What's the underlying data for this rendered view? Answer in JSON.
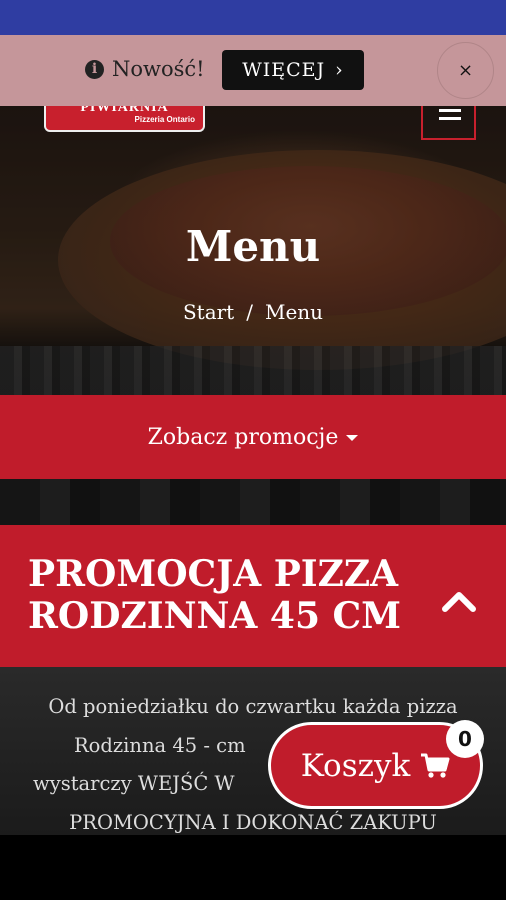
{
  "notice": {
    "text": "Nowość!",
    "button_label": "WIĘCEJ",
    "button_chevron": "›",
    "close_label": "×",
    "info_icon_glyph": "i"
  },
  "header": {
    "logo_top": "PIWIARNIA",
    "logo_sub": "Pizzeria Ontario"
  },
  "hero": {
    "title": "Menu",
    "breadcrumb": [
      "Start",
      "/",
      "Menu"
    ]
  },
  "promo_bar": {
    "label": "Zobacz promocje"
  },
  "accordion": {
    "title": "PROMOCJA PIZZA RODZINNA 45 CM"
  },
  "description": {
    "lines": [
      "Od poniedziałku do czwartku każda pizza",
      "Rodzinna 45 - cm",
      "wystarczy WEJŚĆ W",
      "PROMOCYJNA I DOKONAĆ ZAKUPU"
    ]
  },
  "cart": {
    "label": "Koszyk",
    "count": "0"
  },
  "colors": {
    "status_bar": "#2f3da2",
    "notice_bg": "#c5969a",
    "brand_red": "#c01c2b"
  }
}
